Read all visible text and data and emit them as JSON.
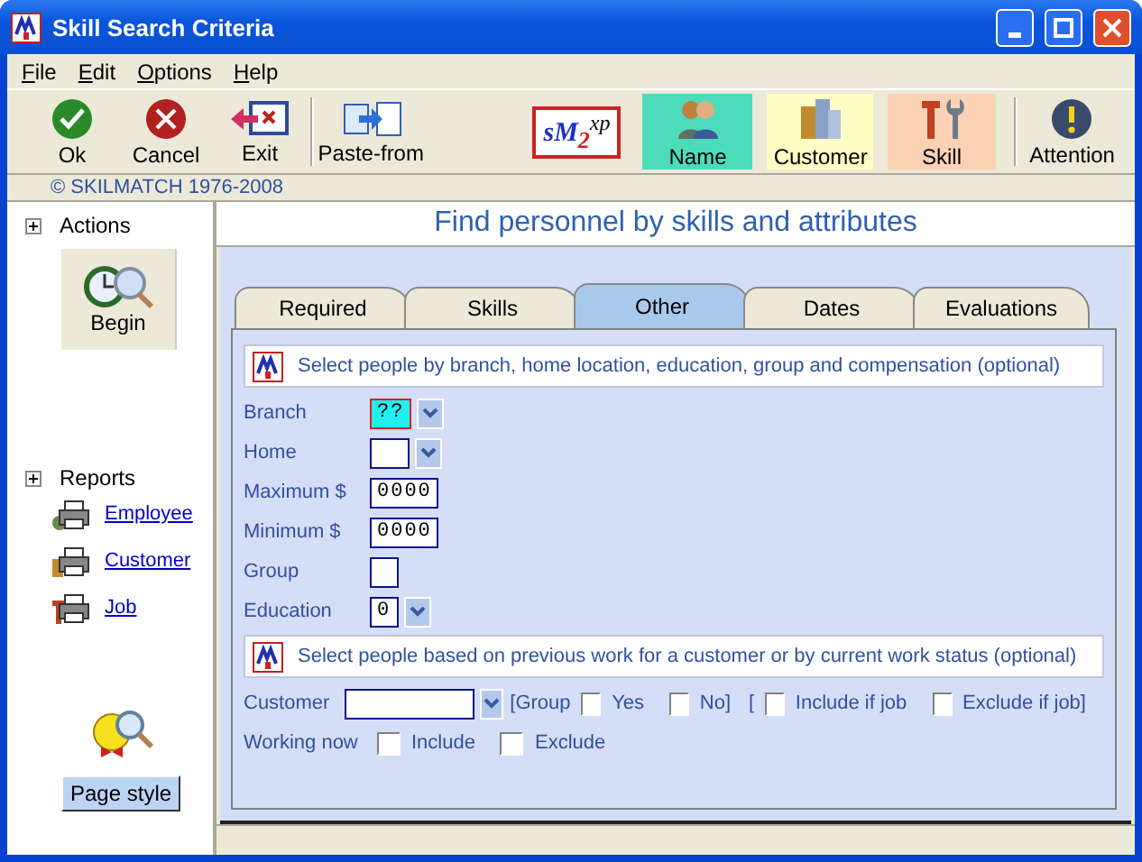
{
  "window": {
    "title": "Skill Search Criteria"
  },
  "menu": [
    {
      "label": "File"
    },
    {
      "label": "Edit"
    },
    {
      "label": "Options"
    },
    {
      "label": "Help"
    }
  ],
  "toolbar": {
    "actions": [
      {
        "kind": "ok",
        "label": "Ok"
      },
      {
        "kind": "cancel",
        "label": "Cancel"
      },
      {
        "kind": "exit",
        "label": "Exit"
      },
      {
        "kind": "paste",
        "label": "Paste-from"
      }
    ],
    "logo": "sM$_{2}$$^{xp}$",
    "modes": [
      {
        "kind": "name",
        "label": "Name",
        "color": "#4cdcbc"
      },
      {
        "kind": "customer",
        "label": "Customer",
        "color": "#fffcc4"
      },
      {
        "kind": "skill",
        "label": "Skill",
        "color": "#fcd2b4"
      }
    ],
    "attention": {
      "label": "Attention"
    }
  },
  "copyright": "© SKILMATCH 1976-2008",
  "sidebar": {
    "actions": {
      "title": "Actions",
      "button": "Begin"
    },
    "reports": {
      "title": "Reports",
      "links": [
        {
          "kind": "employee",
          "label": "Employee"
        },
        {
          "kind": "customer",
          "label": "Customer"
        },
        {
          "kind": "job",
          "label": "Job"
        }
      ]
    },
    "page_style": "Page style"
  },
  "heading": "Find personnel by skills and attributes",
  "tabs": [
    {
      "label": "Required",
      "selected": false
    },
    {
      "label": "Skills",
      "selected": false
    },
    {
      "label": "Other",
      "selected": true
    },
    {
      "label": "Dates",
      "selected": false
    },
    {
      "label": "Evaluations",
      "selected": false
    }
  ],
  "sections": [
    {
      "header": "Select people by branch, home location, education, group and compensation (optional)",
      "rows": [
        {
          "label": "Branch",
          "controls": [
            {
              "kind": "combo",
              "value": "??",
              "highlighted": true
            }
          ]
        },
        {
          "label": "Home",
          "controls": [
            {
              "kind": "combo",
              "highlighted": false
            }
          ]
        },
        {
          "label": "Maximum $",
          "controls": [
            {
              "kind": "field",
              "value": "0000",
              "highlighted": false
            }
          ]
        },
        {
          "label": "Minimum $",
          "controls": [
            {
              "kind": "field",
              "value": "0000",
              "highlighted": false
            }
          ]
        },
        {
          "label": "Group",
          "controls": [
            {
              "kind": "field",
              "highlighted": false
            }
          ]
        },
        {
          "label": "Education",
          "controls": [
            {
              "kind": "combo",
              "value": "0",
              "highlighted": false
            }
          ]
        }
      ]
    },
    {
      "header": "Select people based on previous work for a customer or by current work status (optional)",
      "rows": [
        {
          "label": "Customer",
          "controls": [
            {
              "kind": "lookup",
              "highlighted": false
            },
            {
              "kind": "text",
              "text": "[Group"
            },
            {
              "kind": "checkbox",
              "label": "Yes",
              "checked": false
            },
            {
              "kind": "checkbox",
              "label": "No]",
              "checked": false
            },
            {
              "kind": "text",
              "text": "["
            },
            {
              "kind": "checkbox",
              "label": "Include if job",
              "checked": false
            },
            {
              "kind": "checkbox",
              "label": "Exclude if job]",
              "checked": false
            }
          ]
        },
        {
          "label": "Working now",
          "controls": [
            {
              "kind": "checkbox",
              "label": "Include",
              "checked": false
            },
            {
              "kind": "checkbox",
              "label": "Exclude",
              "checked": false
            }
          ]
        }
      ]
    }
  ]
}
